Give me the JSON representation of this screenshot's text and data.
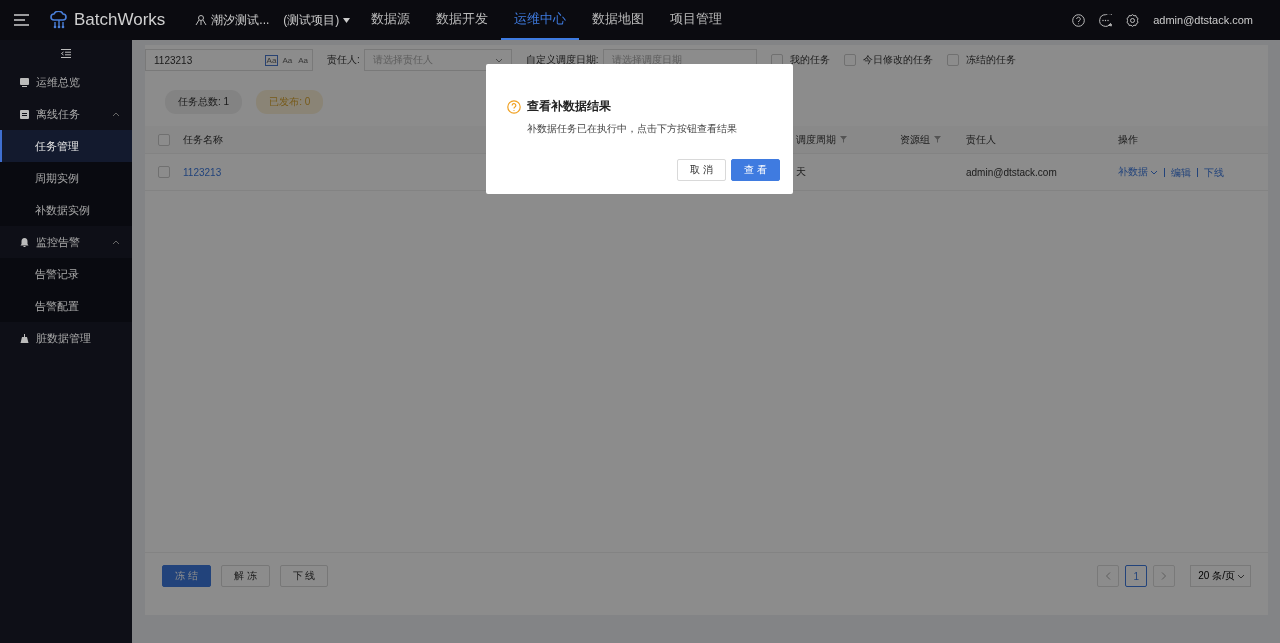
{
  "topbar": {
    "brand": "BatchWorks",
    "project": {
      "name": "潮汐测试...",
      "tag": "(测试项目)"
    },
    "nav": [
      {
        "label": "数据源",
        "selected": false
      },
      {
        "label": "数据开发",
        "selected": false
      },
      {
        "label": "运维中心",
        "selected": true
      },
      {
        "label": "数据地图",
        "selected": false
      },
      {
        "label": "项目管理",
        "selected": false
      }
    ],
    "user": "admin@dtstack.com"
  },
  "sidebar": {
    "items": [
      {
        "label": "运维总览",
        "kind": "monitor",
        "selected": false
      },
      {
        "label": "离线任务",
        "kind": "task",
        "expanded": true,
        "selected": false,
        "children": [
          {
            "label": "任务管理",
            "selected": true
          },
          {
            "label": "周期实例",
            "selected": false
          },
          {
            "label": "补数据实例",
            "selected": false
          }
        ]
      },
      {
        "label": "监控告警",
        "kind": "bell",
        "expanded": true,
        "selected": false,
        "children": [
          {
            "label": "告警记录",
            "selected": false
          },
          {
            "label": "告警配置",
            "selected": false
          }
        ]
      },
      {
        "label": "脏数据管理",
        "kind": "broom",
        "selected": false
      }
    ]
  },
  "filters": {
    "search": {
      "value": "1123213",
      "options": [
        {
          "label": "Aa",
          "selected": true
        },
        {
          "label": "Aa",
          "selected": false
        },
        {
          "label": "Aa",
          "selected": false
        }
      ]
    },
    "owner": {
      "label": "责任人:",
      "placeholder": "请选择责任人"
    },
    "date": {
      "label": "自定义调度日期:",
      "placeholder": "请选择调度日期"
    },
    "checks": [
      {
        "label": "我的任务",
        "checked": false
      },
      {
        "label": "今日修改的任务",
        "checked": false
      },
      {
        "label": "冻结的任务",
        "checked": false
      }
    ]
  },
  "summary": [
    {
      "label": "任务总数: 1",
      "kind": "total"
    },
    {
      "label": "已发布: 0",
      "kind": "published"
    }
  ],
  "table": {
    "select_all": false,
    "columns": [
      {
        "label": "任务名称",
        "filter": false
      },
      {
        "label": "调度周期",
        "filter": true
      },
      {
        "label": "资源组",
        "filter": true
      },
      {
        "label": "责任人",
        "filter": false
      },
      {
        "label": "操作",
        "filter": false
      }
    ],
    "rows": [
      {
        "checked": false,
        "name": "1123213",
        "period": "天",
        "owner": "admin@dtstack.com",
        "actions": [
          {
            "label": "补数据",
            "dropdown": true
          },
          {
            "label": "编辑",
            "dropdown": false
          },
          {
            "label": "下线",
            "dropdown": false
          }
        ]
      }
    ]
  },
  "footer": {
    "buttons": [
      {
        "label": "冻 结",
        "primary": true
      },
      {
        "label": "解 冻",
        "primary": false
      },
      {
        "label": "下 线",
        "primary": false
      }
    ],
    "pagination": {
      "pages": [
        {
          "label": "1",
          "selected": true
        }
      ],
      "size": "20 条/页"
    }
  },
  "modal": {
    "title": "查看补数据结果",
    "message": "补数据任务已在执行中，点击下方按钮查看结果",
    "buttons": [
      {
        "label": "取 消",
        "primary": false
      },
      {
        "label": "查 看",
        "primary": true
      }
    ]
  }
}
